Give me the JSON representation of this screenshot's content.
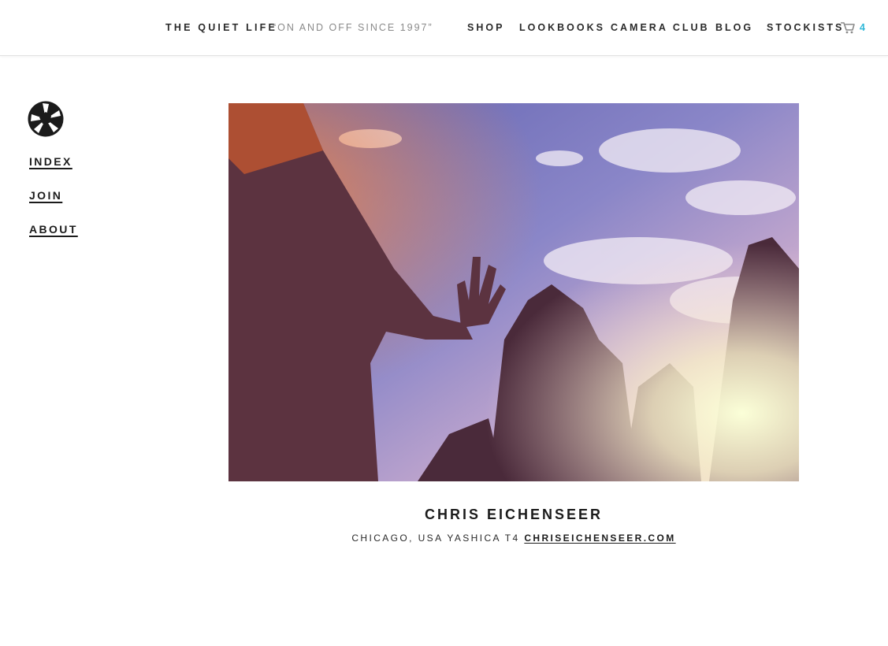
{
  "header": {
    "brand": "THE QUIET LIFE",
    "tagline": "“ON AND OFF SINCE 1997”",
    "nav": [
      "SHOP",
      "LOOKBOOKS",
      "CAMERA CLUB",
      "BLOG",
      "STOCKISTS"
    ],
    "cart_icon": "shopping-cart-icon",
    "cart_count": "4",
    "cart_count_color": "#2fb8d8"
  },
  "sidebar": {
    "logo_icon": "camera-aperture-icon",
    "items": [
      {
        "label": "INDEX"
      },
      {
        "label": "JOIN"
      },
      {
        "label": "ABOUT"
      }
    ]
  },
  "main": {
    "photo_name": "CHRIS EICHENSEER",
    "location": "CHICAGO, USA",
    "camera": "YASHICA T4",
    "website": "CHRISEICHENSEER.COM"
  },
  "colors": {
    "text": "#1b1b1b",
    "muted": "#8a8a8a",
    "accent": "#2fb8d8"
  }
}
